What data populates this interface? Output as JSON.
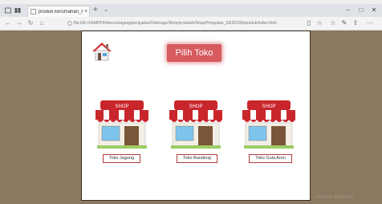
{
  "browser": {
    "tab_title": "produk kerumahan_t",
    "tab_close_glyph": "×",
    "new_tab_glyph": "+",
    "tab_menu_glyph": "⌄",
    "url": "file:///E:/XAMPP/htdocs/magang/penjualan/Olahraga/Shop/produk/b/Shop/Penjualan_03/2020/b/produk/index.html",
    "window_controls": {
      "minimize": "–",
      "maximize": "□",
      "close": "✕"
    },
    "nav": {
      "back": "←",
      "forward": "→",
      "refresh": "↻",
      "home": "⌂"
    },
    "right_icons": {
      "reading": "▯",
      "favorite": "☆",
      "favorites_bar": "☆",
      "notes": "✎",
      "share": "⇪",
      "more": "···"
    }
  },
  "page": {
    "title": "Pilih Toko",
    "home_icon": "home-icon",
    "shops": [
      {
        "label": "Toko Jagung",
        "sign": "SHOP"
      },
      {
        "label": "Toko Bandeng",
        "sign": "SHOP"
      },
      {
        "label": "Toko Gula Aren",
        "sign": "SHOP"
      }
    ]
  },
  "os": {
    "watermark": "Activate Windows"
  },
  "colors": {
    "title_bg": "#d65a5e",
    "awning_red": "#c9262c",
    "page_bg": "#8c7760"
  }
}
